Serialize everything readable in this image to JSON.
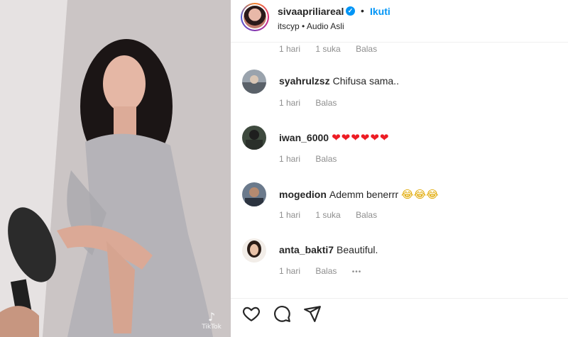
{
  "post": {
    "username": "sivaapriliareal",
    "follow_label": "Ikuti",
    "audio_user": "itscyp",
    "audio_label": "Audio Asli",
    "separator": "•"
  },
  "media": {
    "watermark": "TikTok"
  },
  "comments": {
    "top_meta": {
      "time": "1 hari",
      "likes": "1 suka",
      "reply": "Balas"
    },
    "items": [
      {
        "username": "syahrulzsz",
        "text": "Chifusa sama..",
        "time": "1 hari",
        "likes": "",
        "reply": "Balas"
      },
      {
        "username": "iwan_6000",
        "text": "❤❤❤❤❤❤",
        "time": "1 hari",
        "likes": "",
        "reply": "Balas"
      },
      {
        "username": "mogedion",
        "text": "Ademm benerrr",
        "emoji": "😂😂😂",
        "time": "1 hari",
        "likes": "1 suka",
        "reply": "Balas"
      },
      {
        "username": "anta_bakti7",
        "text": "Beautiful.",
        "time": "1 hari",
        "likes": "",
        "reply": "Balas",
        "more": "•••"
      }
    ]
  },
  "actions": {
    "like_icon": "heart-icon",
    "comment_icon": "comment-bubble-icon",
    "share_icon": "send-icon"
  },
  "colors": {
    "accent": "#0095f6",
    "secondary_text": "#8e8e8e",
    "heart": "#ed1c24"
  }
}
